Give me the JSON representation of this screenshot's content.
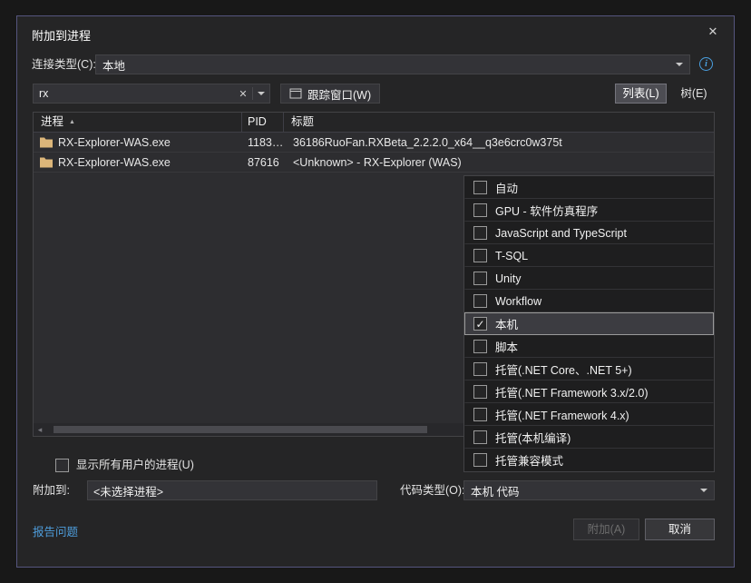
{
  "icons": {
    "close": "✕",
    "clear": "✕",
    "sort_asc": "▲",
    "check": "✓",
    "info": "i",
    "scroll_left": "◂",
    "scroll_right": "▸"
  },
  "colors": {
    "link": "#4e9ddb",
    "folder": "#dcb67a",
    "dialog_border": "#55557e"
  },
  "dialog": {
    "title": "附加到进程"
  },
  "connection": {
    "label": "连接类型(C):",
    "value": "本地"
  },
  "toolbar": {
    "search_value": "rx",
    "track_window": "跟踪窗口(W)",
    "list": "列表(L)",
    "tree": "树(E)"
  },
  "table": {
    "columns": [
      "进程",
      "PID",
      "标题"
    ],
    "rows": [
      {
        "process": "RX-Explorer-WAS.exe",
        "pid": "1183…",
        "title": "36186RuoFan.RXBeta_2.2.2.0_x64__q3e6crc0w375t"
      },
      {
        "process": "RX-Explorer-WAS.exe",
        "pid": "87616",
        "title": "<Unknown> - RX-Explorer (WAS)"
      }
    ]
  },
  "code_type_popup": {
    "items": [
      {
        "label": "自动",
        "checked": false
      },
      {
        "label": "GPU - 软件仿真程序",
        "checked": false
      },
      {
        "label": "JavaScript and TypeScript",
        "checked": false
      },
      {
        "label": "T-SQL",
        "checked": false
      },
      {
        "label": "Unity",
        "checked": false
      },
      {
        "label": "Workflow",
        "checked": false
      },
      {
        "label": "本机",
        "checked": true
      },
      {
        "label": "脚本",
        "checked": false
      },
      {
        "label": "托管(.NET Core、.NET 5+)",
        "checked": false
      },
      {
        "label": "托管(.NET Framework 3.x/2.0)",
        "checked": false
      },
      {
        "label": "托管(.NET Framework 4.x)",
        "checked": false
      },
      {
        "label": "托管(本机编译)",
        "checked": false
      },
      {
        "label": "托管兼容模式",
        "checked": false
      }
    ]
  },
  "options": {
    "show_all_users": "显示所有用户的进程(U)"
  },
  "attach_to": {
    "label": "附加到:",
    "value": "<未选择进程>"
  },
  "code_type": {
    "label": "代码类型(O):",
    "value": "本机 代码"
  },
  "footer": {
    "report": "报告问题",
    "attach": "附加(A)",
    "cancel": "取消"
  }
}
